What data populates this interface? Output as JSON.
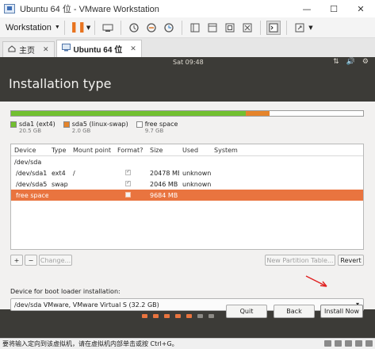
{
  "window": {
    "title": "Ubuntu 64 位 - VMware Workstation",
    "minimize_glyph": "—",
    "maximize_glyph": "☐",
    "close_glyph": "✕"
  },
  "toolbar": {
    "menu_label": "Workstation",
    "icons": [
      "pause-icon",
      "send-keys-icon",
      "snapshot-icon",
      "revert-snapshot-icon",
      "snapshot-manager-icon",
      "sidebar-toggle-icon",
      "console-view-icon",
      "full-screen-icon",
      "unity-icon",
      "terminal-icon",
      "stretch-icon"
    ]
  },
  "tabs": [
    {
      "label": "主页",
      "icon": "home-icon"
    },
    {
      "label": "Ubuntu 64 位",
      "icon": "vm-icon",
      "active": true
    }
  ],
  "guest_topbar": {
    "clock": "Sat 09:48",
    "tray": [
      "⇅",
      "🔊",
      "⚙"
    ]
  },
  "installer": {
    "title": "Installation type",
    "colors": {
      "sda1": "#72c030",
      "sda5": "#e5842b",
      "free": "#ffffff",
      "selected_row": "#e9743f"
    },
    "disk_usage_fractions": {
      "sda1": 0.6666,
      "sda5": 0.0666,
      "free": 0.2668
    },
    "legend": [
      {
        "name": "sda1 (ext4)",
        "size": "20.5 GB"
      },
      {
        "name": "sda5 (linux-swap)",
        "size": "2.0 GB"
      },
      {
        "name": "free space",
        "size": "9.7 GB"
      }
    ],
    "table": {
      "columns": [
        "Device",
        "Type",
        "Mount point",
        "Format?",
        "Size",
        "Used",
        "System"
      ],
      "rows": [
        {
          "device": "/dev/sda",
          "type": "",
          "mount": "",
          "format": null,
          "size": "",
          "used": "",
          "system": ""
        },
        {
          "device": "/dev/sda1",
          "type": "ext4",
          "mount": "/",
          "format": true,
          "size": "20478 MB",
          "used": "unknown",
          "system": ""
        },
        {
          "device": "/dev/sda5",
          "type": "swap",
          "mount": "",
          "format": true,
          "size": "2046 MB",
          "used": "unknown",
          "system": ""
        },
        {
          "device": "free space",
          "type": "",
          "mount": "",
          "format": false,
          "size": "9684 MB",
          "used": "",
          "system": "",
          "selected": true
        }
      ]
    },
    "add_label": "+",
    "remove_label": "−",
    "change_label": "Change...",
    "new_table_label": "New Partition Table...",
    "revert_label": "Revert",
    "boot_loader_label": "Device for boot loader installation:",
    "boot_loader_value": "/dev/sda   VMware, VMware Virtual S (32.2 GB)",
    "quit_label": "Quit",
    "back_label": "Back",
    "install_label": "Install Now",
    "progress_dots": {
      "total": 7,
      "active": 5
    }
  },
  "statusbar": {
    "text": "要将输入定向到该虚拟机，请在虚拟机内部单击或按 Ctrl+G。"
  }
}
